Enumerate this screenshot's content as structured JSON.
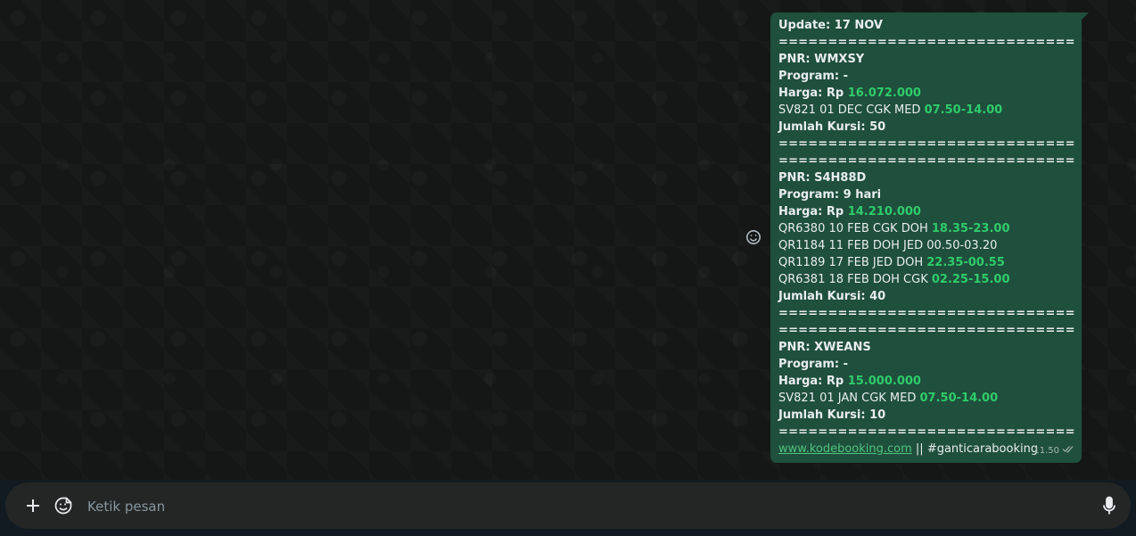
{
  "message": {
    "update": "Update: 17 NOV",
    "separator": "==============================",
    "blocks": [
      {
        "pnr": "PNR: WMXSY",
        "program": "Program: -",
        "harga_label": "Harga: Rp ",
        "harga_value": "16.072.000",
        "flights": [
          {
            "text": "SV821 01 DEC CGK MED ",
            "time": "07.50-14.00",
            "time_highlight": true
          }
        ],
        "kursi": "Jumlah Kursi: 50"
      },
      {
        "pnr": "PNR: S4H88D",
        "program": "Program: 9 hari",
        "harga_label": "Harga: Rp ",
        "harga_value": "14.210.000",
        "flights": [
          {
            "text": "QR6380 10 FEB CGK DOH ",
            "time": "18.35-23.00",
            "time_highlight": true
          },
          {
            "text": "QR1184 11 FEB DOH JED ",
            "time": "00.50-03.20",
            "time_highlight": false
          },
          {
            "text": "QR1189 17 FEB JED DOH ",
            "time": "22.35-00.55",
            "time_highlight": true
          },
          {
            "text": "QR6381 18 FEB DOH CGK ",
            "time": "02.25-15.00",
            "time_highlight": true
          }
        ],
        "kursi": "Jumlah Kursi: 40"
      },
      {
        "pnr": "PNR: XWEANS",
        "program": "Program: -",
        "harga_label": "Harga: Rp ",
        "harga_value": "15.000.000",
        "flights": [
          {
            "text": "SV821 01 JAN CGK MED ",
            "time": "07.50-14.00",
            "time_highlight": true
          }
        ],
        "kursi": "Jumlah Kursi: 10"
      }
    ],
    "link": "www.kodebooking.com",
    "link_suffix": " || #ganticarabooking",
    "time": "11.50",
    "status_icon": "double-check-icon"
  },
  "composer": {
    "placeholder": "Ketik pesan",
    "value": "",
    "plus_icon": "plus-icon",
    "sticker_icon": "sticker-icon",
    "mic_icon": "mic-icon"
  },
  "colors": {
    "bubble": "#1f4f3d",
    "highlight": "#2fcc6a",
    "link": "#4fc47c"
  }
}
